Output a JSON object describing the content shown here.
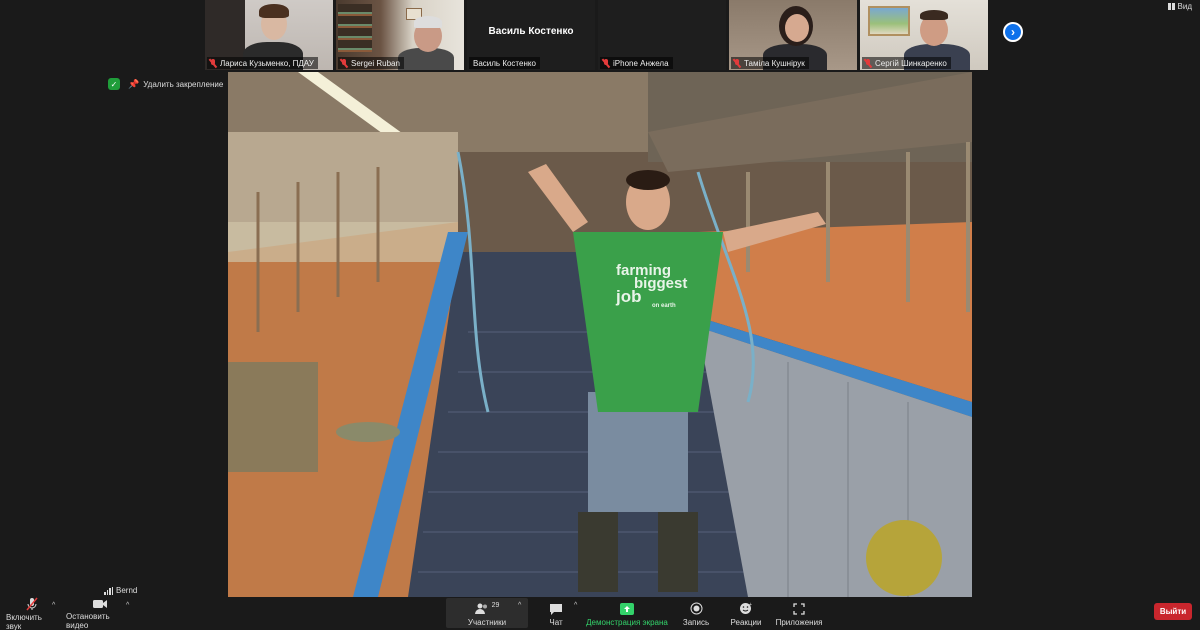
{
  "gallery": {
    "tiles": [
      {
        "name": "Лариса Кузьменко, ПДАУ",
        "muted": true,
        "has_video": true
      },
      {
        "name": "Sergei Ruban",
        "muted": true,
        "has_video": true
      },
      {
        "name": "Василь Костенко",
        "muted": false,
        "has_video": false,
        "center_name": "Василь Костенко"
      },
      {
        "name": "iPhone Анжела",
        "muted": true,
        "has_video": false
      },
      {
        "name": "Таміла Кушнірук",
        "muted": true,
        "has_video": true
      },
      {
        "name": "Сергій Шинкаренко",
        "muted": true,
        "has_video": true
      }
    ],
    "next_icon": "chevron-right-icon"
  },
  "header": {
    "view_label": "Вид",
    "unpin_label": "Удалить закрепление"
  },
  "main_video": {
    "shirt_text_1": "farming",
    "shirt_text_2": "biggest",
    "shirt_text_3": "job",
    "shirt_text_4": "on earth",
    "speaker_name": "Bernd"
  },
  "toolbar": {
    "mute_label": "Включить звук",
    "video_label": "Остановить видео",
    "participants_label": "Участники",
    "participants_count": "29",
    "chat_label": "Чат",
    "share_label": "Демонстрация экрана",
    "record_label": "Запись",
    "reactions_label": "Реакции",
    "apps_label": "Приложения",
    "exit_label": "Выйти"
  },
  "colors": {
    "accent_blue": "#0e71eb",
    "share_green": "#33d26a",
    "exit_red": "#c9262d",
    "muted_red": "#e23b3b"
  }
}
